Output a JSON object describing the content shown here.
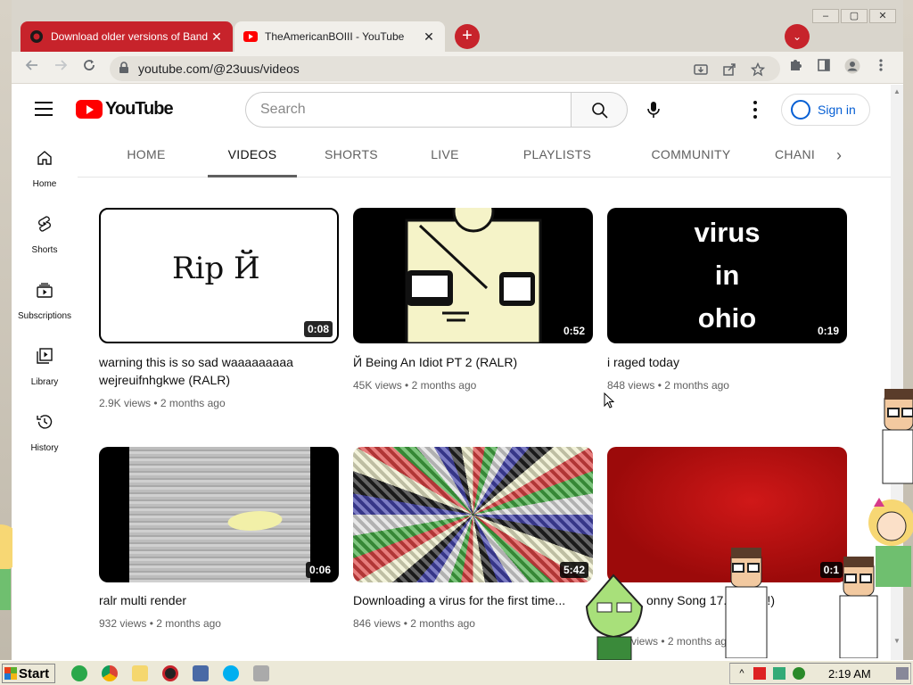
{
  "window_controls": {
    "minimize": "–",
    "maximize": "▢",
    "close": "✕"
  },
  "tabs": [
    {
      "title": "Download older versions of Band",
      "close": "✕"
    },
    {
      "title": "TheAmericanBOIII - YouTube",
      "close": "✕"
    }
  ],
  "new_tab_label": "+",
  "tab_search_label": "⌄",
  "address_bar": {
    "url": "youtube.com/@23uus/videos"
  },
  "youtube": {
    "logo_text": "YouTube",
    "search_placeholder": "Search",
    "sign_in_label": "Sign in",
    "guide": [
      {
        "label": "Home",
        "icon": "home-icon"
      },
      {
        "label": "Shorts",
        "icon": "shorts-icon"
      },
      {
        "label": "Subscriptions",
        "icon": "subscriptions-icon"
      },
      {
        "label": "Library",
        "icon": "library-icon"
      },
      {
        "label": "History",
        "icon": "history-icon"
      }
    ],
    "channel_tabs": [
      "HOME",
      "VIDEOS",
      "SHORTS",
      "LIVE",
      "PLAYLISTS",
      "COMMUNITY",
      "CHANI"
    ],
    "active_tab": "VIDEOS",
    "videos": [
      {
        "title": "warning this is so sad waaaaaaaaa wejreuifnhgkwe (RALR)",
        "views": "2.9K views",
        "age": "2 months ago",
        "duration": "0:08",
        "thumb_text": "Rip Й"
      },
      {
        "title": "Й Being An Idiot PT 2 (RALR)",
        "views": "45K views",
        "age": "2 months ago",
        "duration": "0:52"
      },
      {
        "title": "i raged today",
        "views": "848 views",
        "age": "2 months ago",
        "duration": "0:19",
        "thumb_text": [
          "virus",
          "in",
          "ohio"
        ]
      },
      {
        "title": "ralr multi render",
        "views": "932 views",
        "age": "2 months ago",
        "duration": "0:06"
      },
      {
        "title": "Downloading a virus for the first time...",
        "views": "846 views",
        "age": "2 months ago",
        "duration": "5:42"
      },
      {
        "title": "onny Song 17. psy g!!!)",
        "views": "views",
        "age": "2 months ago",
        "duration": "0:1"
      }
    ]
  },
  "taskbar": {
    "start_label": "Start",
    "clock": "2:19 AM"
  },
  "colors": {
    "chrome_red": "#c7232b",
    "youtube_red": "#ff0000",
    "link_blue": "#065fd4"
  }
}
